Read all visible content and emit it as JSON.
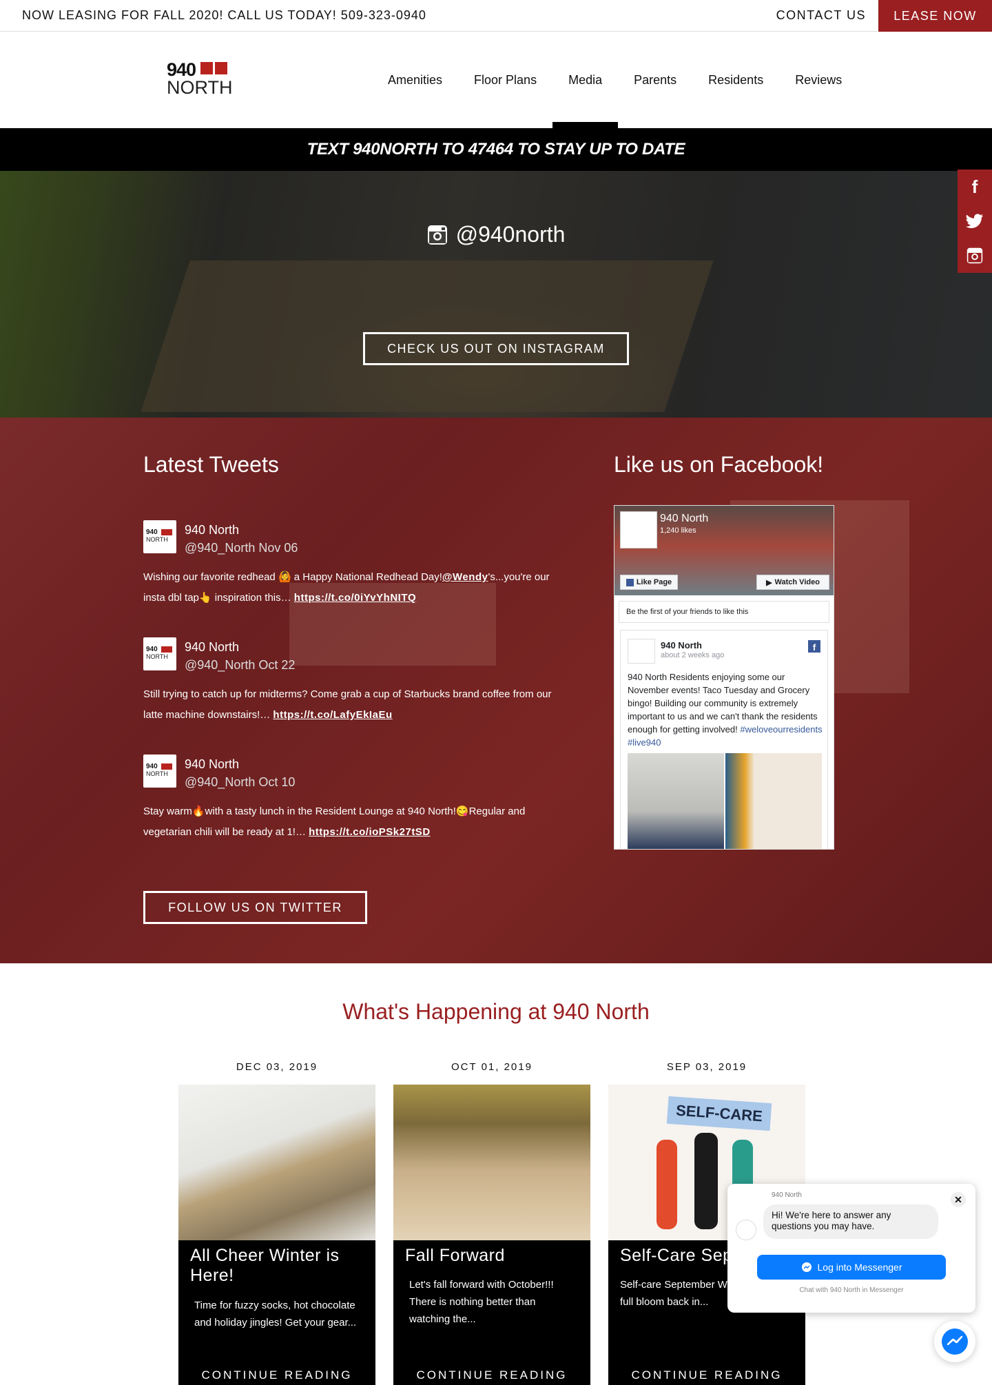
{
  "topbar": {
    "lease_message": "NOW LEASING FOR FALL 2020! CALL US TODAY! 509-323-0940",
    "contact": "CONTACT US",
    "lease_now": "LEASE NOW"
  },
  "logo": {
    "number": "940",
    "word": "NORTH"
  },
  "nav": {
    "items": [
      "Amenities",
      "Floor Plans",
      "Media",
      "Parents",
      "Residents",
      "Reviews"
    ],
    "active": "Media"
  },
  "text_banner": "TEXT 940NORTH TO 47464 TO STAY UP TO DATE",
  "instagram": {
    "handle": "@940north",
    "cta": "CHECK US OUT ON INSTAGRAM"
  },
  "social_icons": [
    "facebook-icon",
    "twitter-icon",
    "instagram-icon"
  ],
  "tweets": {
    "heading": "Latest Tweets",
    "items": [
      {
        "name": "940 North",
        "handle_date": "@940_North Nov 06",
        "text": "Wishing our favorite redhead 🙆 a Happy National Redhead Day!",
        "mention": "@Wendy",
        "text2": "'s...you're our insta dbl tap👆 inspiration this… ",
        "link": "https://t.co/0iYvYhNITQ"
      },
      {
        "name": "940 North",
        "handle_date": "@940_North Oct 22",
        "text": "Still trying to catch up for midterms? Come grab a cup of Starbucks brand coffee from our latte machine downstairs!… ",
        "mention": "",
        "text2": "",
        "link": "https://t.co/LafyEkIaEu"
      },
      {
        "name": "940 North",
        "handle_date": "@940_North Oct 10",
        "text": "Stay warm🔥with a tasty lunch in the Resident Lounge at 940 North!😋Regular and vegetarian chili will be ready at 1!… ",
        "mention": "",
        "text2": "",
        "link": "https://t.co/ioPSk27tSD"
      }
    ],
    "follow": "FOLLOW US ON TWITTER"
  },
  "facebook": {
    "heading": "Like us on Facebook!",
    "page_name": "940 North",
    "likes": "1,240 likes",
    "like_page": "Like Page",
    "watch_video": "Watch Video",
    "friends_text": "Be the first of your friends to like this",
    "post": {
      "author": "940 North",
      "time": "about 2 weeks ago",
      "text": "940 North Residents enjoying some our November events! Taco Tuesday and Grocery bingo! Building our community is extremely important to us and we can't thank the residents enough for getting involved!",
      "tags": "#weloveourresidents #live940"
    }
  },
  "happening": {
    "title": "What's Happening at 940 North",
    "cards": [
      {
        "date": "DEC 03, 2019",
        "title": "All Cheer Winter is Here!",
        "excerpt": "Time for fuzzy socks, hot chocolate and holiday jingles! Get your gear...",
        "more": "CONTINUE READING"
      },
      {
        "date": "OCT 01, 2019",
        "title": "Fall Forward",
        "excerpt": "Let's fall forward with October!!! There is nothing better than watching the...",
        "more": "CONTINUE READING"
      },
      {
        "date": "SEP 03, 2019",
        "title": "Self-Care Sept",
        "excerpt": "Self-care September  W coming into full bloom back in...",
        "more": "CONTINUE READING",
        "banner": "SELF-CARE"
      }
    ]
  },
  "messenger": {
    "from": "940 North",
    "greeting": "Hi! We're here to answer any questions you may have.",
    "login": "Log into Messenger",
    "footer": "Chat with 940 North in Messenger"
  },
  "colors": {
    "brand_red": "#9a1f21",
    "messenger_blue": "#0a7cff",
    "facebook_blue": "#3b5998"
  }
}
